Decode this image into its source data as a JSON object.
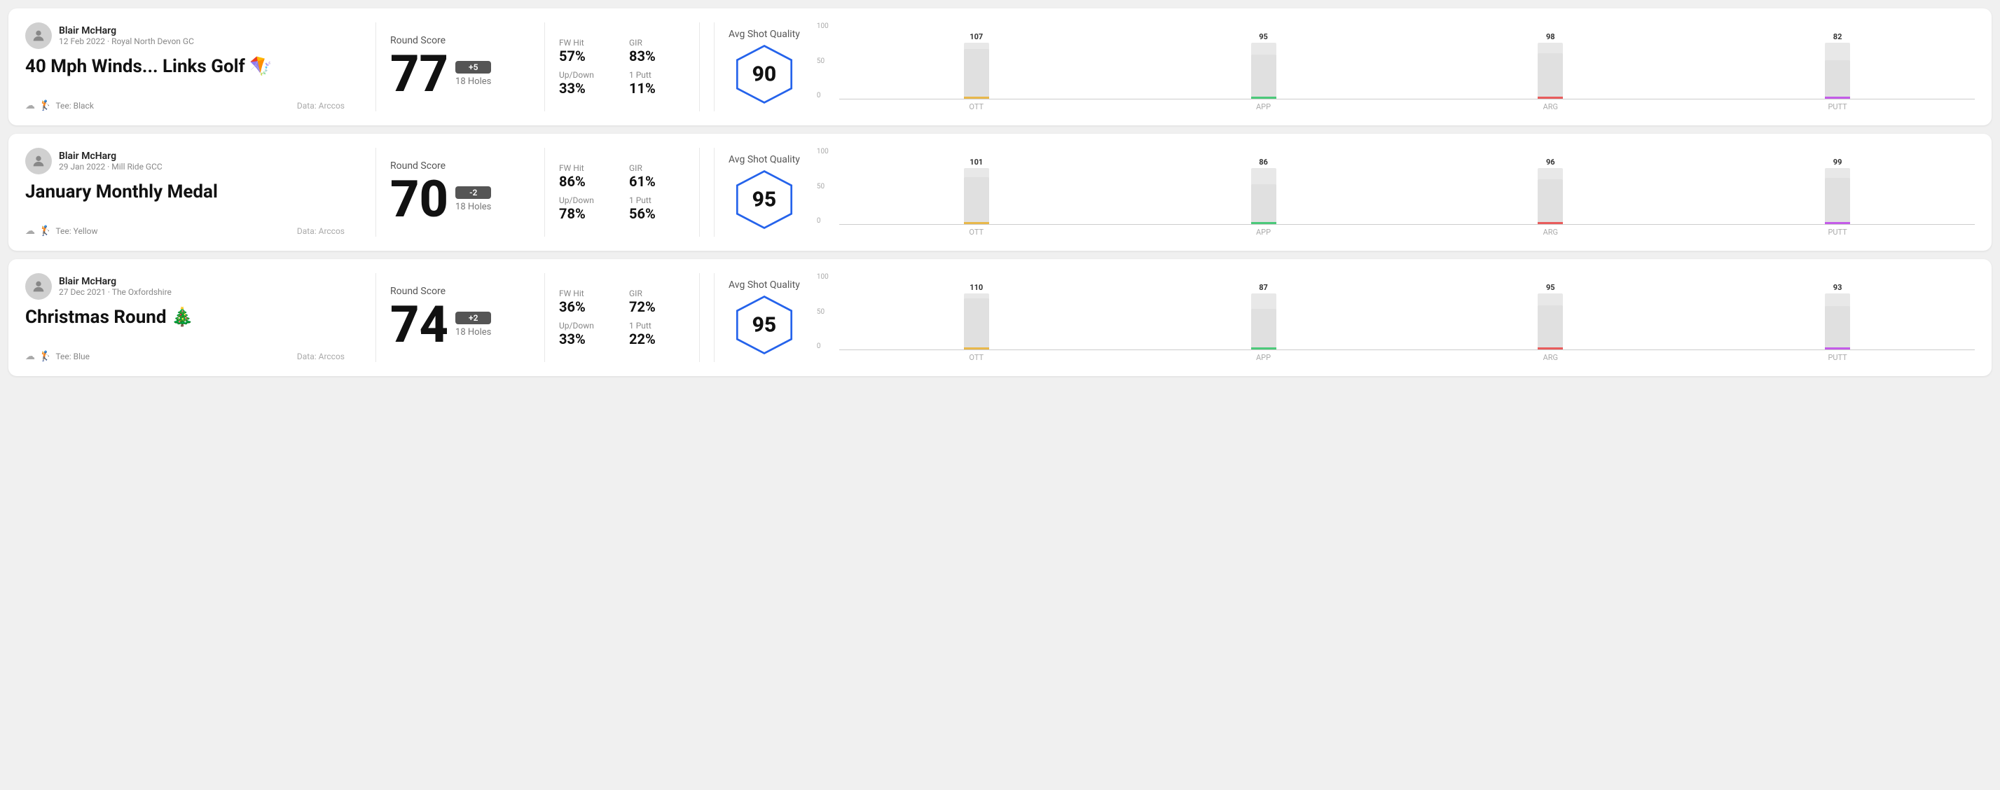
{
  "rounds": [
    {
      "id": "round1",
      "user": {
        "name": "Blair McHarg",
        "date": "12 Feb 2022 · Royal North Devon GC"
      },
      "title": "40 Mph Winds... Links Golf",
      "title_emoji": "🪁",
      "tee": "Black",
      "data_source": "Data: Arccos",
      "score": {
        "label": "Round Score",
        "value": "77",
        "badge": "+5",
        "badge_type": "positive",
        "holes": "18 Holes"
      },
      "stats": {
        "fw_hit_label": "FW Hit",
        "fw_hit_value": "57%",
        "gir_label": "GIR",
        "gir_value": "83%",
        "updown_label": "Up/Down",
        "updown_value": "33%",
        "putt1_label": "1 Putt",
        "putt1_value": "11%"
      },
      "avg_shot_quality": {
        "label": "Avg Shot Quality",
        "score": "90"
      },
      "chart": {
        "bars": [
          {
            "category": "OTT",
            "value": 107,
            "max": 120,
            "color": "#e8b84b"
          },
          {
            "category": "APP",
            "value": 95,
            "max": 120,
            "color": "#4bc97a"
          },
          {
            "category": "ARG",
            "value": 98,
            "max": 120,
            "color": "#e85c5c"
          },
          {
            "category": "PUTT",
            "value": 82,
            "max": 120,
            "color": "#c45ce8"
          }
        ],
        "y_max": 100,
        "y_labels": [
          "100",
          "50",
          "0"
        ]
      }
    },
    {
      "id": "round2",
      "user": {
        "name": "Blair McHarg",
        "date": "29 Jan 2022 · Mill Ride GCC"
      },
      "title": "January Monthly Medal",
      "title_emoji": "",
      "tee": "Yellow",
      "data_source": "Data: Arccos",
      "score": {
        "label": "Round Score",
        "value": "70",
        "badge": "-2",
        "badge_type": "negative",
        "holes": "18 Holes"
      },
      "stats": {
        "fw_hit_label": "FW Hit",
        "fw_hit_value": "86%",
        "gir_label": "GIR",
        "gir_value": "61%",
        "updown_label": "Up/Down",
        "updown_value": "78%",
        "putt1_label": "1 Putt",
        "putt1_value": "56%"
      },
      "avg_shot_quality": {
        "label": "Avg Shot Quality",
        "score": "95"
      },
      "chart": {
        "bars": [
          {
            "category": "OTT",
            "value": 101,
            "max": 120,
            "color": "#e8b84b"
          },
          {
            "category": "APP",
            "value": 86,
            "max": 120,
            "color": "#4bc97a"
          },
          {
            "category": "ARG",
            "value": 96,
            "max": 120,
            "color": "#e85c5c"
          },
          {
            "category": "PUTT",
            "value": 99,
            "max": 120,
            "color": "#c45ce8"
          }
        ],
        "y_max": 100,
        "y_labels": [
          "100",
          "50",
          "0"
        ]
      }
    },
    {
      "id": "round3",
      "user": {
        "name": "Blair McHarg",
        "date": "27 Dec 2021 · The Oxfordshire"
      },
      "title": "Christmas Round",
      "title_emoji": "🎄",
      "tee": "Blue",
      "data_source": "Data: Arccos",
      "score": {
        "label": "Round Score",
        "value": "74",
        "badge": "+2",
        "badge_type": "positive",
        "holes": "18 Holes"
      },
      "stats": {
        "fw_hit_label": "FW Hit",
        "fw_hit_value": "36%",
        "gir_label": "GIR",
        "gir_value": "72%",
        "updown_label": "Up/Down",
        "updown_value": "33%",
        "putt1_label": "1 Putt",
        "putt1_value": "22%"
      },
      "avg_shot_quality": {
        "label": "Avg Shot Quality",
        "score": "95"
      },
      "chart": {
        "bars": [
          {
            "category": "OTT",
            "value": 110,
            "max": 120,
            "color": "#e8b84b"
          },
          {
            "category": "APP",
            "value": 87,
            "max": 120,
            "color": "#4bc97a"
          },
          {
            "category": "ARG",
            "value": 95,
            "max": 120,
            "color": "#e85c5c"
          },
          {
            "category": "PUTT",
            "value": 93,
            "max": 120,
            "color": "#c45ce8"
          }
        ],
        "y_max": 100,
        "y_labels": [
          "100",
          "50",
          "0"
        ]
      }
    }
  ]
}
